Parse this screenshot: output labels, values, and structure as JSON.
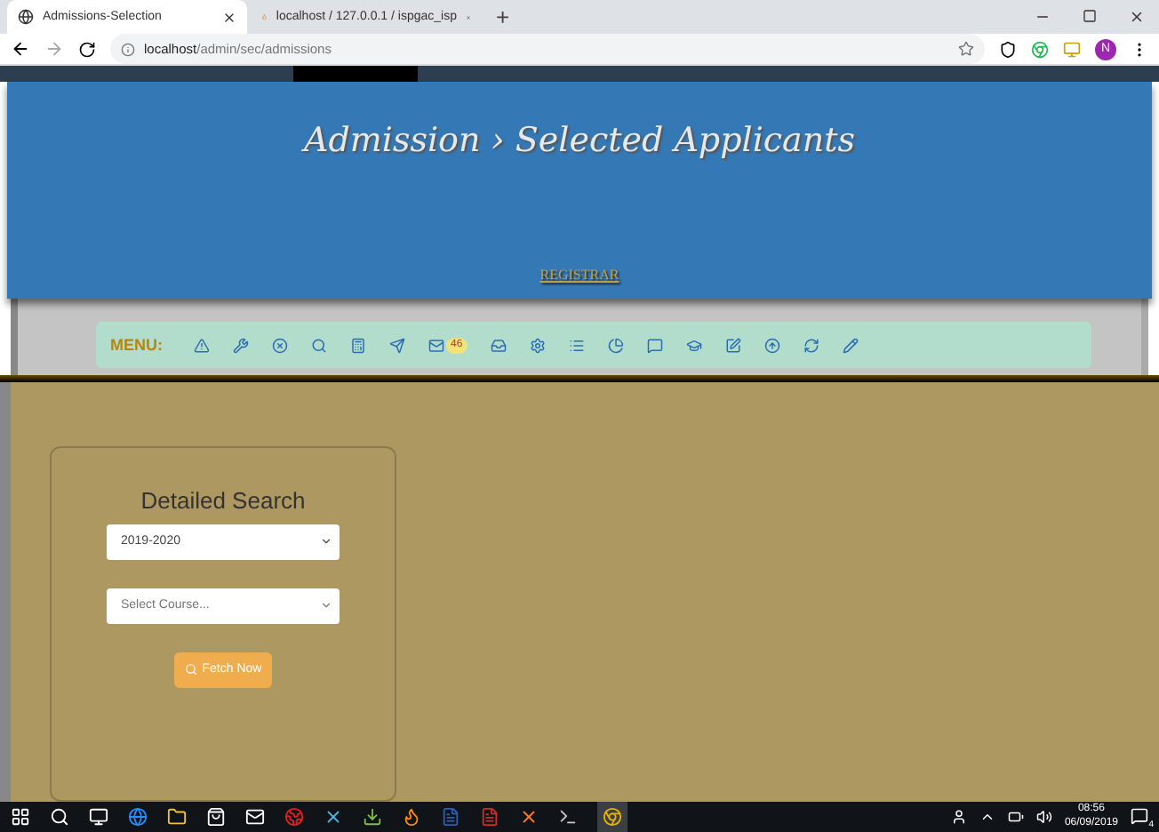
{
  "browser": {
    "tabs": [
      {
        "title": "Admissions-Selection",
        "selected": true
      },
      {
        "title": "localhost / 127.0.0.1 / ispgac_isp",
        "selected": false
      }
    ],
    "new_tab": "+",
    "url_host": "localhost",
    "url_path": "/admin/sec/admissions",
    "profile_initial": "N"
  },
  "header": {
    "title": "Admission › Selected Applicants",
    "link": "REGISTRAR"
  },
  "menu": {
    "label": "MENU:",
    "mail_badge": "46"
  },
  "search_panel": {
    "title": "Detailed Search",
    "session_select": {
      "value": "2019-2020"
    },
    "course_select": {
      "placeholder": "Select Course..."
    },
    "button": "Fetch Now"
  },
  "taskbar": {
    "time": "08:56",
    "date": "06/09/2019",
    "notification_count": "4"
  }
}
